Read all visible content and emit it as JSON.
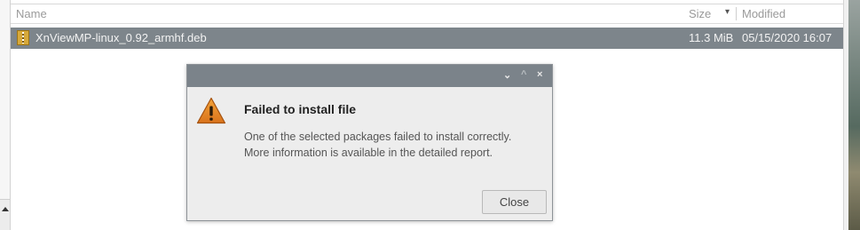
{
  "file_list": {
    "columns": {
      "name": "Name",
      "size": "Size",
      "sort_indicator": "▾",
      "modified": "Modified"
    },
    "rows": [
      {
        "name": "XnViewMP-linux_0.92_armhf.deb",
        "size": "11.3 MiB",
        "modified": "05/15/2020 16:07",
        "icon": "archive-package-icon"
      }
    ]
  },
  "dialog": {
    "title_buttons": {
      "minimize": "⌄",
      "maximize": "^",
      "close": "×"
    },
    "icon": "warning-icon",
    "title": "Failed to install file",
    "message_lines": [
      "One of the selected packages failed to install correctly.",
      "More information is available in the detailed report."
    ],
    "close_label": "Close"
  },
  "colors": {
    "titlebar": "#7b838a",
    "selection": "#7d858b",
    "warning": "#e8892a"
  }
}
